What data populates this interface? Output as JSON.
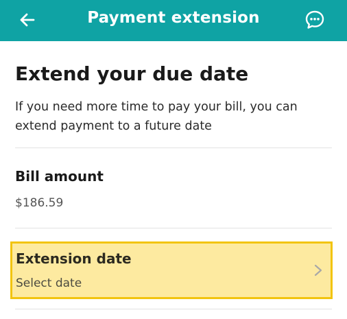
{
  "header": {
    "title": "Payment extension",
    "back_icon": "arrow-left-icon",
    "chat_icon": "chat-bubble-icon",
    "background_color": "#0fa3a4"
  },
  "main": {
    "heading": "Extend your due date",
    "description": "If you need more time to pay your bill, you can extend payment to a future date",
    "bill": {
      "label": "Bill amount",
      "value": "$186.59"
    },
    "extension": {
      "label": "Extension date",
      "placeholder": "Select date",
      "chevron_icon": "chevron-right-icon",
      "highlight_color": "#fdeaa0",
      "highlight_border": "#f2c40f"
    }
  }
}
